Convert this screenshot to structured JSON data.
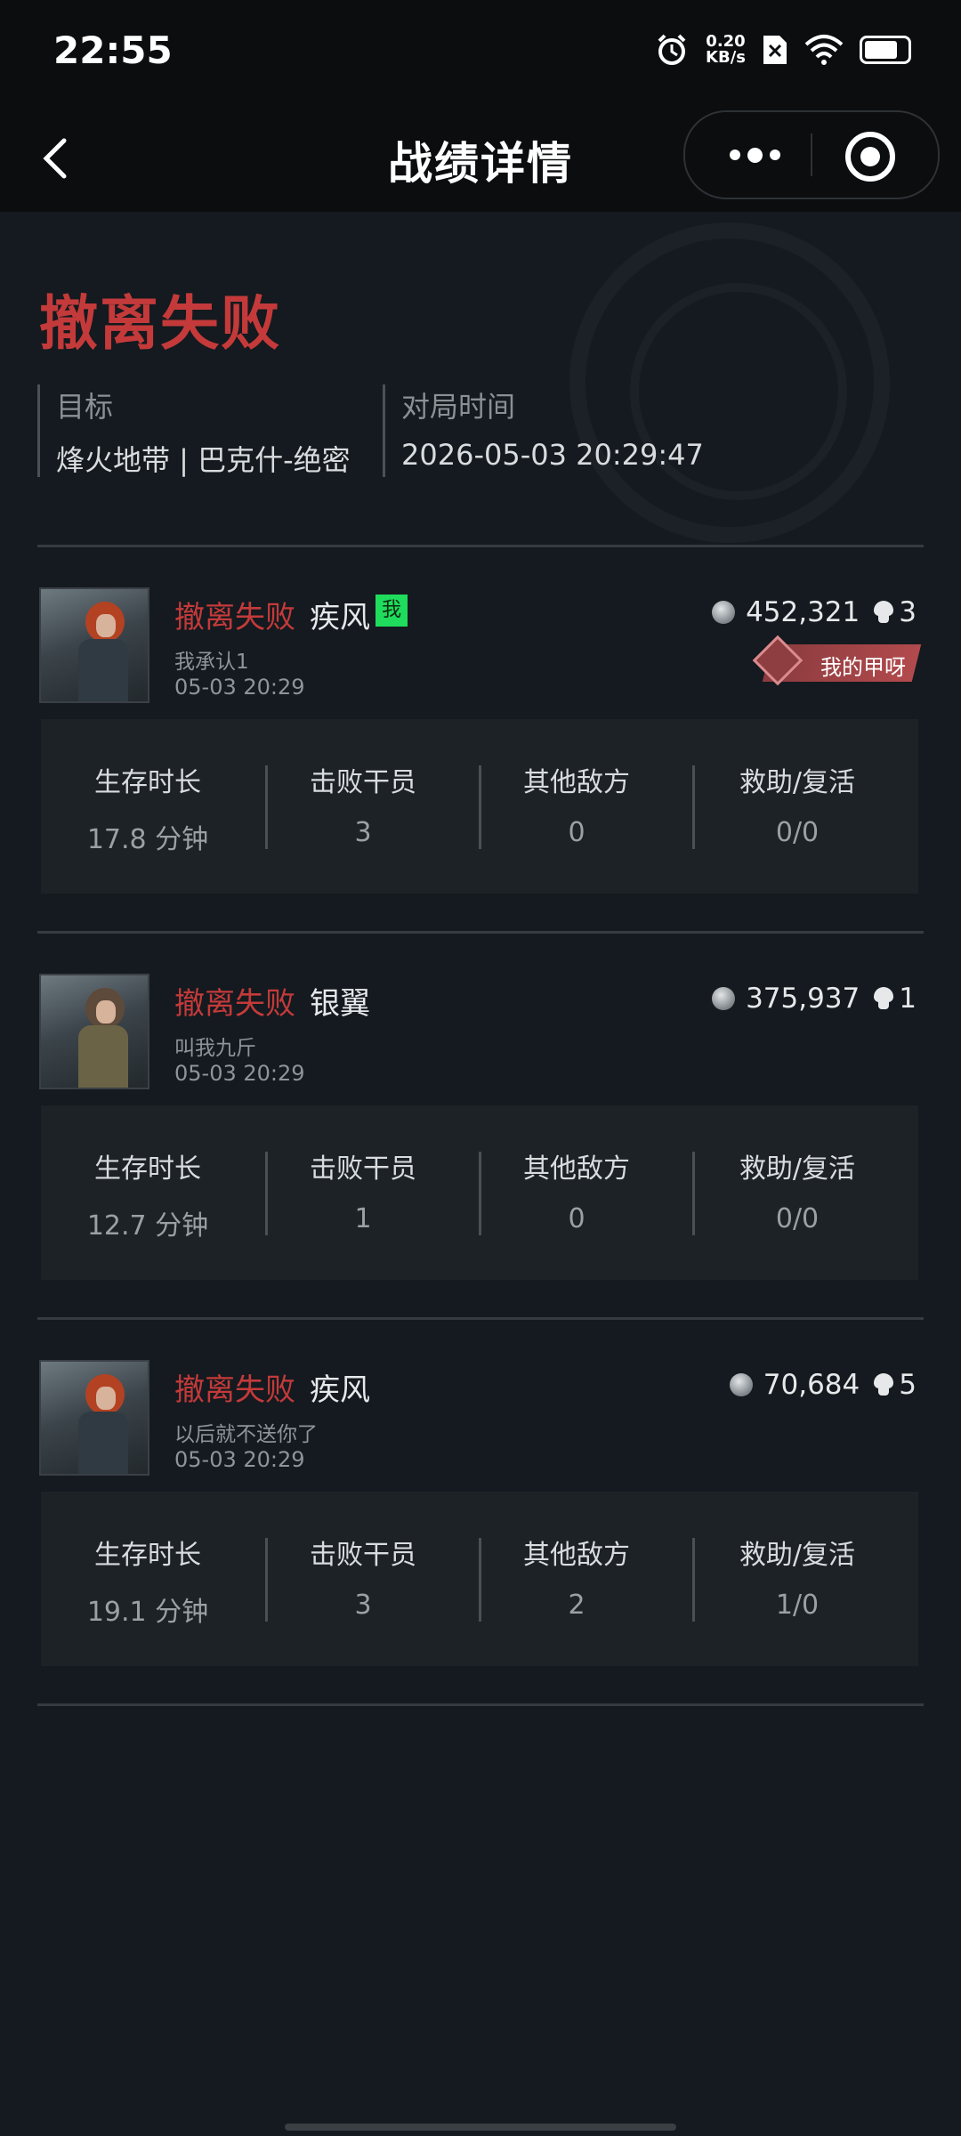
{
  "status_bar": {
    "time": "22:55",
    "net_speed_value": "0.20",
    "net_speed_unit": "KB/s",
    "icons": [
      "alarm-icon",
      "network-speed-icon",
      "no-sim-icon",
      "wifi-icon",
      "battery-icon"
    ]
  },
  "nav": {
    "title": "战绩详情",
    "back_icon": "chevron-left-icon",
    "more_icon": "more-dots-icon",
    "close_icon": "target-close-icon"
  },
  "summary": {
    "result": "撤离失败",
    "target_label": "目标",
    "target_value": "烽火地带 | 巴克什-绝密",
    "time_label": "对局时间",
    "time_value": "2026-05-03 20:29:47"
  },
  "stat_labels": [
    "生存时长",
    "击败干员",
    "其他敌方",
    "救助/复活"
  ],
  "players": [
    {
      "status": "撤离失败",
      "name": "疾风",
      "me_badge": "我",
      "subtitle": "我承认1",
      "time": "05-03 20:29",
      "value": "452,321",
      "kills": "3",
      "tag": "我的甲呀",
      "stats": [
        "17.8 分钟",
        "3",
        "0",
        "0/0"
      ]
    },
    {
      "status": "撤离失败",
      "name": "银翼",
      "subtitle": "叫我九斤",
      "time": "05-03 20:29",
      "value": "375,937",
      "kills": "1",
      "stats": [
        "12.7 分钟",
        "1",
        "0",
        "0/0"
      ]
    },
    {
      "status": "撤离失败",
      "name": "疾风",
      "subtitle": "以后就不送你了",
      "time": "05-03 20:29",
      "value": "70,684",
      "kills": "5",
      "stats": [
        "19.1 分钟",
        "3",
        "2",
        "1/0"
      ]
    }
  ],
  "colors": {
    "background": "#141a1f",
    "fail_red": "#c43a3a",
    "me_badge_green": "#1fdc5c",
    "tag_red": "#b24a4d"
  }
}
